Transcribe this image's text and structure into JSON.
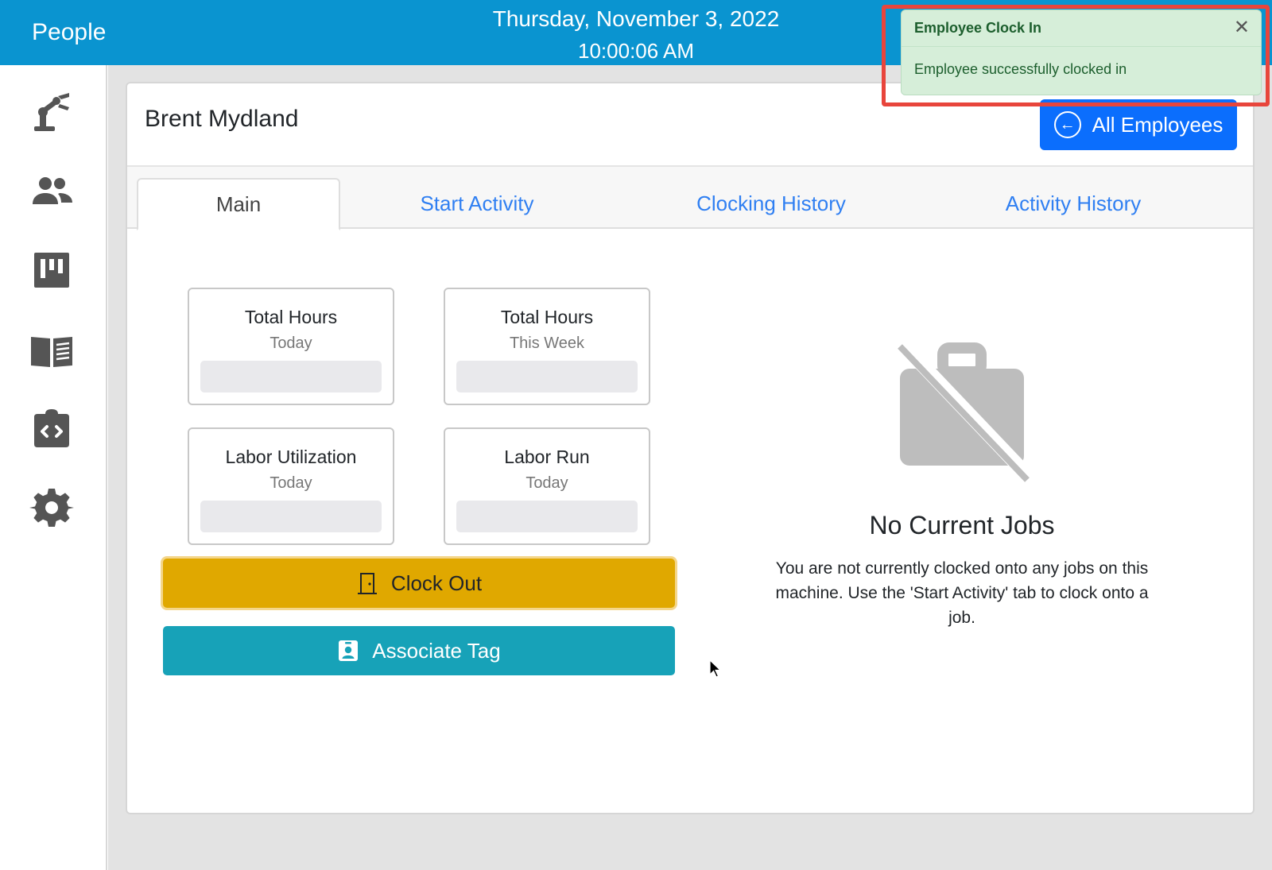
{
  "app": {
    "title": "People"
  },
  "clock": {
    "date": "Thursday, November 3, 2022",
    "time": "10:00:06 AM"
  },
  "sidebar": {
    "items": [
      {
        "icon": "robot-arm-icon"
      },
      {
        "icon": "people-icon"
      },
      {
        "icon": "kanban-board-icon"
      },
      {
        "icon": "open-book-icon"
      },
      {
        "icon": "code-clipboard-icon"
      },
      {
        "icon": "gear-icon"
      }
    ]
  },
  "employee": {
    "name": "Brent Mydland"
  },
  "header": {
    "all_employees_label": "All Employees"
  },
  "tabs": [
    {
      "label": "Main",
      "active": true
    },
    {
      "label": "Start Activity",
      "active": false
    },
    {
      "label": "Clocking History",
      "active": false
    },
    {
      "label": "Activity History",
      "active": false
    }
  ],
  "stats": [
    {
      "title": "Total Hours",
      "sub": "Today"
    },
    {
      "title": "Total Hours",
      "sub": "This Week"
    },
    {
      "title": "Labor Utilization",
      "sub": "Today"
    },
    {
      "title": "Labor Run",
      "sub": "Today"
    }
  ],
  "actions": {
    "clock_out_label": "Clock Out",
    "associate_tag_label": "Associate Tag"
  },
  "no_jobs": {
    "title": "No Current Jobs",
    "message": "You are not currently clocked onto any jobs on this machine. Use the 'Start Activity' tab to clock onto a job."
  },
  "toast": {
    "title": "Employee Clock In",
    "message": "Employee successfully clocked in",
    "close_glyph": "✕"
  },
  "colors": {
    "topbar": "#0a94d0",
    "primary": "#0b6efd",
    "warning": "#e0a800",
    "info": "#17a2b8",
    "toast_bg": "#d6eed9",
    "highlight": "#e8453c"
  }
}
